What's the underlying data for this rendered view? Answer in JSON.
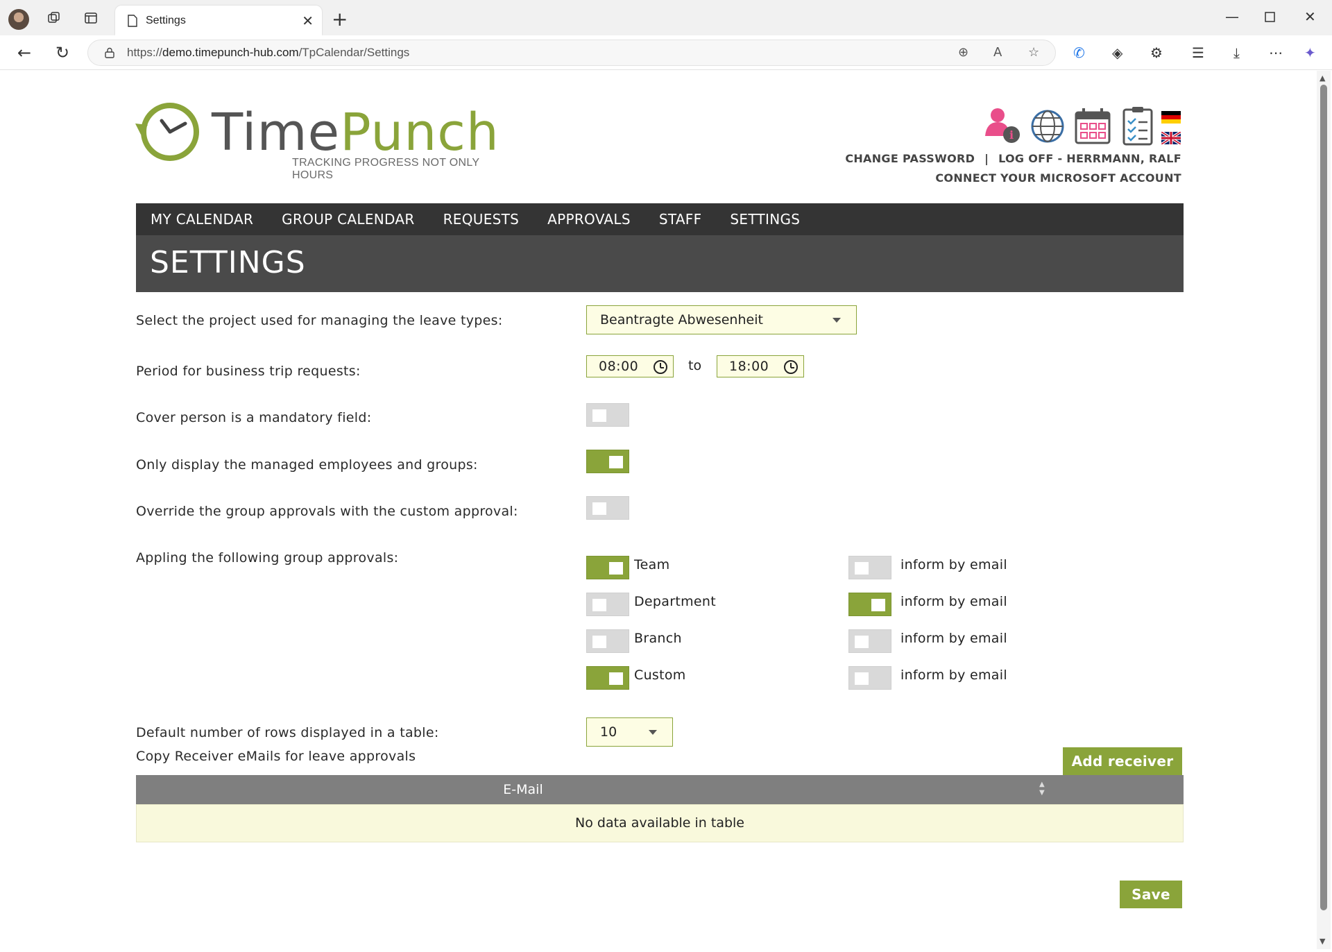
{
  "browser": {
    "tab_title": "Settings",
    "url_prefix": "https://",
    "url_host": "demo.timepunch-hub.com",
    "url_path": "/TpCalendar/Settings"
  },
  "header": {
    "logo_word_1": "Time",
    "logo_word_2": "Punch",
    "logo_tagline": "TRACKING PROGRESS NOT ONLY HOURS",
    "link_change_password": "CHANGE PASSWORD",
    "link_separator": "|",
    "link_logoff": "LOG OFF - HERRMANN, RALF",
    "link_connect_microsoft": "CONNECT YOUR MICROSOFT ACCOUNT",
    "icons": [
      "user-info-icon",
      "globe-icon",
      "calendar-icon",
      "checklist-icon",
      "flag-de-icon",
      "flag-uk-icon"
    ]
  },
  "menu": {
    "items": [
      "MY CALENDAR",
      "GROUP CALENDAR",
      "REQUESTS",
      "APPROVALS",
      "STAFF",
      "SETTINGS"
    ]
  },
  "page_title": "SETTINGS",
  "settings": {
    "project_label": "Select the project used for managing the leave types:",
    "project_value": "Beantragte Abwesenheit",
    "business_trip_label": "Period for business trip requests:",
    "business_trip_from": "08:00",
    "business_trip_to_label": "to",
    "business_trip_to": "18:00",
    "cover_person_label": "Cover person is a mandatory field:",
    "cover_person_on": false,
    "managed_only_label": "Only display the managed employees and groups:",
    "managed_only_on": true,
    "override_label": "Override the group approvals with the custom approval:",
    "override_on": false,
    "group_approvals_label": "Appling the following group approvals:",
    "group_approvals": [
      {
        "name": "Team",
        "on": true,
        "email_label": "inform by email",
        "email_on": false
      },
      {
        "name": "Department",
        "on": false,
        "email_label": "inform by email",
        "email_on": true
      },
      {
        "name": "Branch",
        "on": false,
        "email_label": "inform by email",
        "email_on": false
      },
      {
        "name": "Custom",
        "on": true,
        "email_label": "inform by email",
        "email_on": false
      }
    ],
    "rows_label": "Default number of rows displayed in a table:",
    "rows_value": "10",
    "copy_receiver_label": "Copy Receiver eMails for leave approvals",
    "add_receiver_button": "Add receiver",
    "table_header_email": "E-Mail",
    "table_empty": "No data available in table",
    "save_button": "Save"
  },
  "colors": {
    "accent": "#8aa43a",
    "menu_bg": "#343434",
    "title_bg": "#4a4a4a",
    "input_bg": "#fdfde4"
  }
}
